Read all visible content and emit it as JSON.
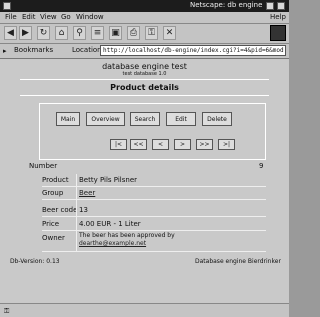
{
  "window": {
    "title": "Netscape: db engine"
  },
  "menu": {
    "file": "File",
    "edit": "Edit",
    "view": "View",
    "go": "Go",
    "window": "Window",
    "help": "Help"
  },
  "location": {
    "bookmarks": "Bookmarks",
    "label": "Location:",
    "url": "http://localhost/db-engine/index.cgi?i=4&pid=6&mod"
  },
  "header": {
    "title": "database engine test",
    "subtitle": "test database 1.0",
    "section": "Product details"
  },
  "actions": {
    "main": "Main",
    "overview": "Overview",
    "search": "Search",
    "edit": "Edit",
    "delete": "Delete"
  },
  "nav": {
    "first": "|<",
    "prev_page": "<<",
    "prev": "<",
    "next": ">",
    "next_page": ">>",
    "last": ">|"
  },
  "fields": {
    "number_label": "Number",
    "number_value": "9",
    "product_label": "Product",
    "product_value": "Betty Pils Pilsner",
    "group_label": "Group",
    "group_value": "Beer",
    "number2_label": "Beer code",
    "number2_value": "13",
    "price_label": "Price",
    "price_value": "4.00 EUR - 1 Liter",
    "owner_label": "Owner",
    "owner_value": "The beer has been approved by",
    "owner_link": "dearthe@example.net"
  },
  "footer": {
    "left": "Db-Version: 0.13",
    "right": "Database engine Bierdrinker"
  }
}
